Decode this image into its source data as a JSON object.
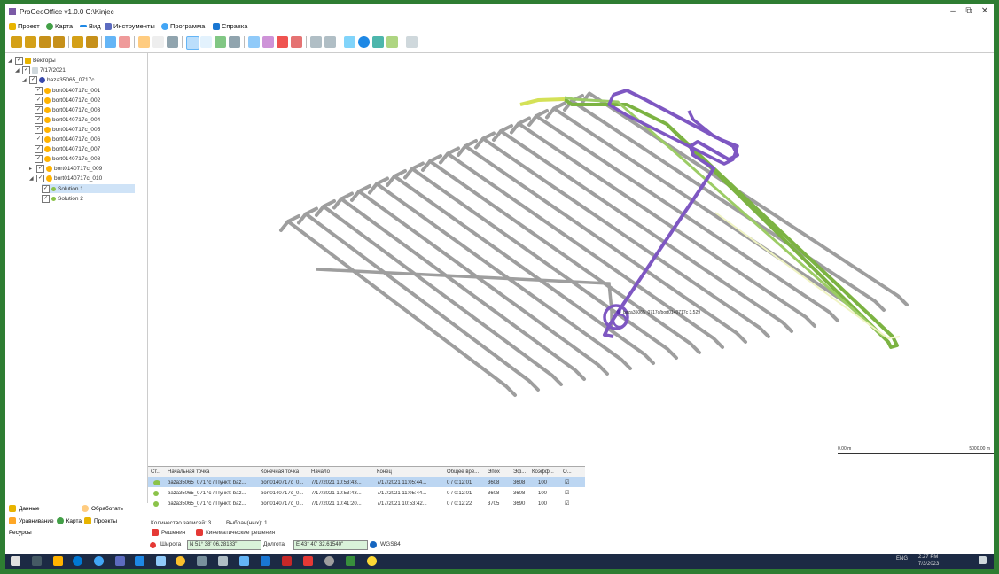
{
  "window": {
    "title": "ProGeoOffice v1.0.0 C:\\Kinjec",
    "controls": [
      "–",
      "⧉",
      "✕"
    ]
  },
  "menu": [
    {
      "label": "Проект",
      "icon": "folder-icon",
      "color": "#e8b400"
    },
    {
      "label": "Карта",
      "icon": "globe-icon",
      "color": "#43a047"
    },
    {
      "label": "Вид",
      "icon": "view-icon",
      "color": "#1e88e5"
    },
    {
      "label": "Инструменты",
      "icon": "tools-icon",
      "color": "#5c6bc0"
    },
    {
      "label": "Программа",
      "icon": "program-icon",
      "color": "#42a5f5"
    },
    {
      "label": "Справка",
      "icon": "help-icon",
      "color": "#1976d2"
    }
  ],
  "tree": {
    "root": "Векторы",
    "date": "7/17/2021",
    "base": "baza35065_0717c",
    "items": [
      "bort0140717c_001",
      "bort0140717c_002",
      "bort0140717c_003",
      "bort0140717c_004",
      "bort0140717c_005",
      "bort0140717c_006",
      "bort0140717c_007",
      "bort0140717c_008",
      "bort0140717c_009",
      "bort0140717c_010"
    ],
    "solutions": [
      "Solution 1",
      "Solution 2"
    ]
  },
  "left_panel": {
    "data_tab": "Данные",
    "process_tab": "Обработать",
    "adjustment": "Уравнивание",
    "map": "Карта",
    "projects": "Проекты",
    "resources": "Ресурсы"
  },
  "map": {
    "point_label": "baza35065_0717c/bort0140717c 3.529",
    "scale_left": "0.00 m",
    "scale_right": "5000.00 m"
  },
  "grid": {
    "columns": [
      "Ст...",
      "Начальная точка",
      "Конечная точка",
      "Начало",
      "Конец",
      "Общее вре...",
      "Эпох",
      "Эф...",
      "Коэфф...",
      "О..."
    ],
    "rows": [
      [
        "",
        "baza35065_0717c / Пункт: baz...",
        "bort0140717c_0...",
        "7/17/2021 10:53:43...",
        "7/17/2021 11:05:44...",
        "0 / 0:12:01",
        "3608",
        "3608",
        "100",
        "☑"
      ],
      [
        "",
        "baza35065_0717c / Пункт: baz...",
        "bort0140717c_0...",
        "7/17/2021 10:53:43...",
        "7/17/2021 11:05:44...",
        "0 / 0:12:01",
        "3608",
        "3608",
        "100",
        "☑"
      ],
      [
        "",
        "baza35065_0717c / Пункт: baz...",
        "bort0140717c_0...",
        "7/17/2021 10:41:20...",
        "7/17/2021 10:53:42...",
        "0 / 0:12:22",
        "3705",
        "3690",
        "100",
        "☑"
      ]
    ]
  },
  "status": {
    "records": "Количество записей: 3",
    "selected": "Выбран(ных): 1"
  },
  "tabs": [
    "Решения",
    "Кинематические решения"
  ],
  "coords": {
    "lat_label": "Широта",
    "lat_value": "N 51° 38' 06.28183\"",
    "lon_label": "Долгота",
    "lon_value": "E 43° 40' 32.61540\"",
    "datum": "WGS84"
  },
  "taskbar": {
    "lang": "ENG",
    "time": "2:27 PM",
    "date": "7/3/2023"
  },
  "colors": {
    "track_gray": "#9e9e9e",
    "track_green": "#7cb342",
    "track_yellow": "#d4e157",
    "track_purple": "#7e57c2",
    "window_frame": "#2e7d32"
  }
}
